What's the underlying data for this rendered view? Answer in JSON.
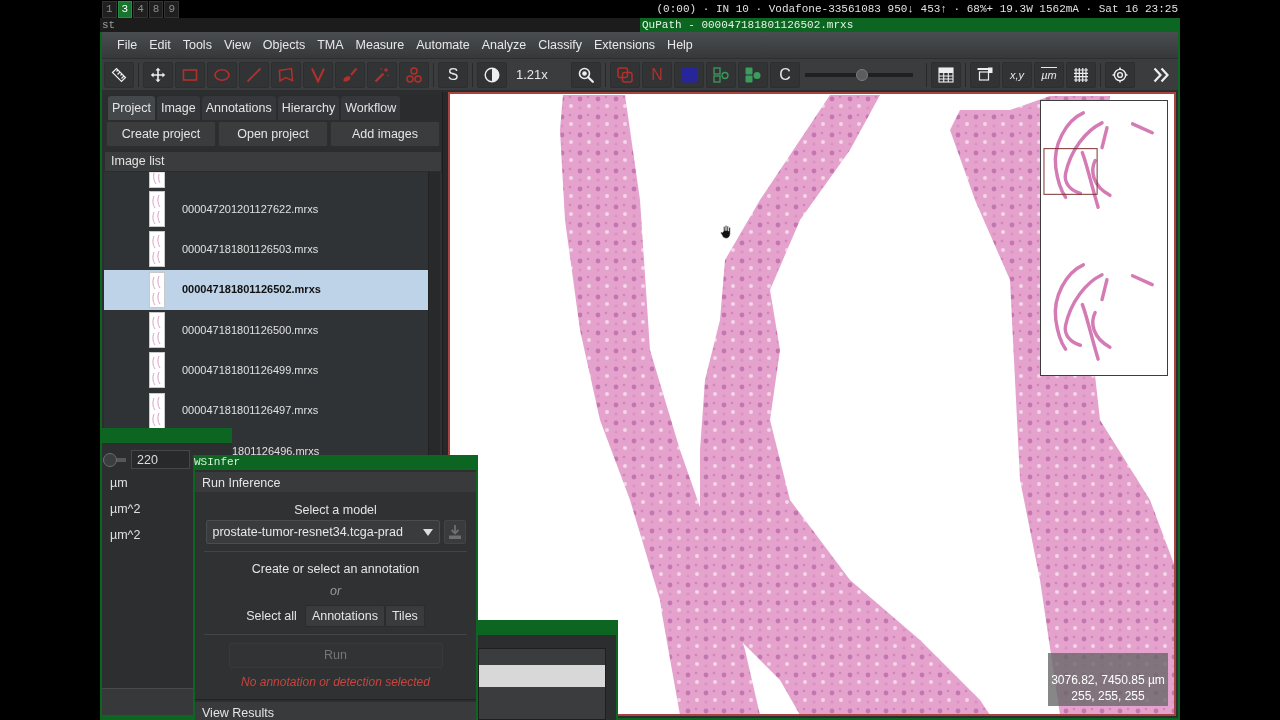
{
  "i3bar": {
    "workspaces": [
      {
        "label": "1",
        "selected": false
      },
      {
        "label": "3",
        "selected": true
      },
      {
        "label": "4",
        "selected": false
      },
      {
        "label": "8",
        "selected": false
      },
      {
        "label": "9",
        "selected": false
      }
    ],
    "status": "(0:00) · IN 10 · Vodafone-33561083 950↓ 453↑ · 68%+ 19.3W 1562mA · Sat 16 23:25"
  },
  "window_tabs": [
    {
      "title": "st",
      "selected": false
    },
    {
      "title": "QuPath - 000047181801126502.mrxs",
      "selected": true
    }
  ],
  "menu": [
    "File",
    "Edit",
    "Tools",
    "View",
    "Objects",
    "TMA",
    "Measure",
    "Automate",
    "Analyze",
    "Classify",
    "Extensions",
    "Help"
  ],
  "toolbar": {
    "s_button": "S",
    "zoom": "1.21x",
    "n_button": "N",
    "c_button": "C",
    "opacity_slider": {
      "level": 0.53
    },
    "xy_button": "x,y",
    "um_button": "µm"
  },
  "left_panel": {
    "tabs": [
      {
        "label": "Project",
        "selected": true
      },
      {
        "label": "Image",
        "selected": false
      },
      {
        "label": "Annotations",
        "selected": false
      },
      {
        "label": "Hierarchy",
        "selected": false
      },
      {
        "label": "Workflow",
        "selected": false
      }
    ],
    "buttons": [
      "Create project",
      "Open project",
      "Add images"
    ],
    "image_list": {
      "title": "Image list",
      "items": [
        {
          "thumbnail": true,
          "selected": false
        },
        {
          "name": "000047201201127622.mrxs",
          "thumbnail": true,
          "selected": false
        },
        {
          "name": "000047181801126503.mrxs",
          "thumbnail": true,
          "selected": false
        },
        {
          "name": "000047181801126502.mrxs",
          "thumbnail": true,
          "selected": true
        },
        {
          "name": "000047181801126500.mrxs",
          "thumbnail": true,
          "selected": false
        },
        {
          "name": "000047181801126499.mrxs",
          "thumbnail": true,
          "selected": false
        },
        {
          "name": "000047181801126497.mrxs",
          "thumbnail": true,
          "selected": false
        },
        {
          "name": "1801126496.mrxs",
          "thumbnail": false,
          "selected": false
        }
      ]
    }
  },
  "viewer": {
    "readout": [
      "3076.82, 7450.85 µm",
      "255, 255, 255"
    ]
  },
  "measure_window": {
    "slider": {
      "level": 0.3
    },
    "value": "220",
    "units": [
      "µm",
      "µm^2",
      "µm^2"
    ]
  },
  "wsinfer": {
    "title": "WSInfer",
    "run_section": {
      "title": "Run Inference",
      "model_label": "Select a model",
      "model": "prostate-tumor-resnet34.tcga-prad",
      "download_button": {
        "disabled": true
      },
      "annotation_hint": "Create or select an annotation",
      "or_label": "or",
      "select_all_label": "Select all",
      "select_buttons": [
        "Annotations",
        "Tiles"
      ],
      "run_button": {
        "label": "Run",
        "disabled": true
      },
      "message": "No annotation or detection selected"
    },
    "results_section": {
      "title": "View Results"
    }
  }
}
